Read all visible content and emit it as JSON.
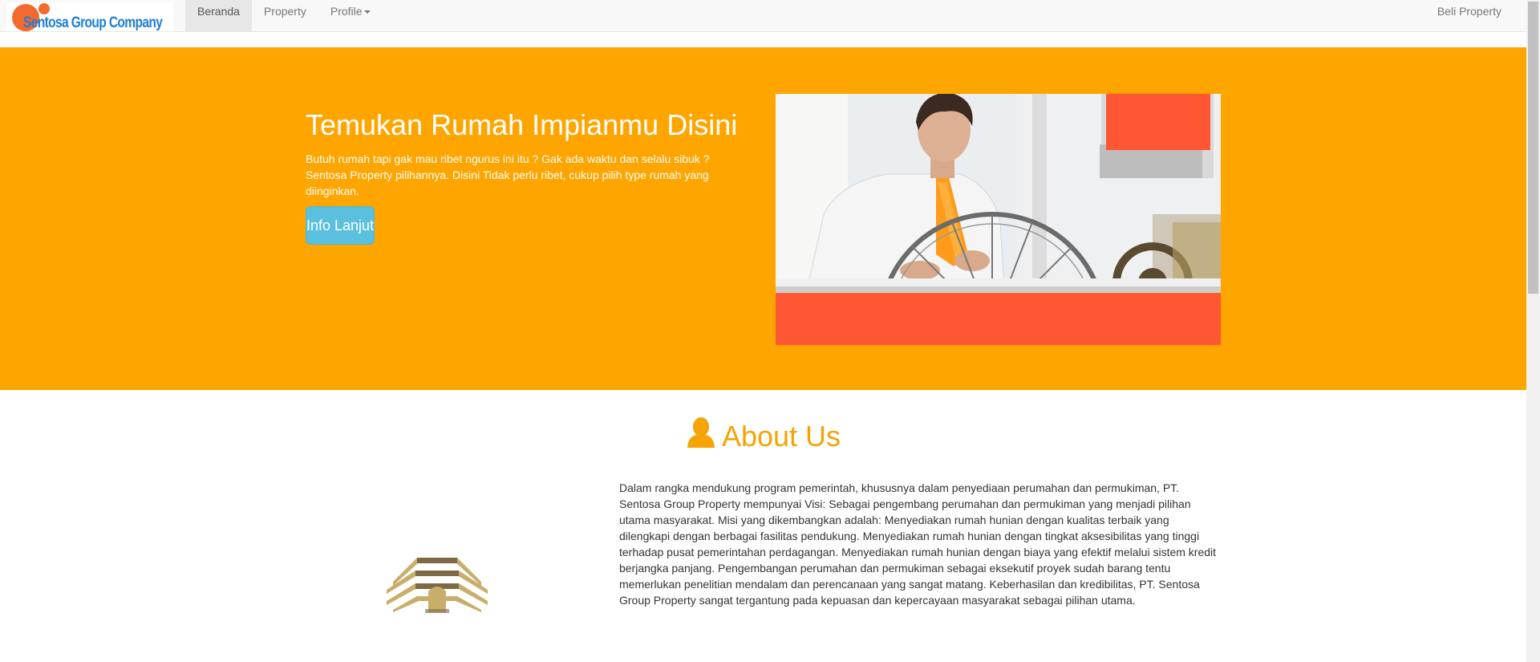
{
  "navbar": {
    "brand": {
      "text": "Sentosa Group Company",
      "icon": "logo-icon",
      "color": "#1e7fd6"
    },
    "items": [
      {
        "label": "Beranda",
        "active": true
      },
      {
        "label": "Property",
        "active": false
      },
      {
        "label": "Profile",
        "active": false,
        "dropdown": true
      }
    ],
    "right_link": "Beli Property"
  },
  "hero": {
    "background_color": "#ffa500",
    "title": "Temukan Rumah Impianmu Disini",
    "text": "Butuh rumah tapi gak mau ribet ngurus ini itu ? Gak ada waktu dan selalu sibuk ? Sentosa Property pilihannya. Disini Tidak perlu ribet, cukup pilih type rumah yang diinginkan.",
    "button_label": "Info Lanjut",
    "button_color": "#5bc0de",
    "image": "man-repairing-bicycle-wheel"
  },
  "about": {
    "icon": "user-icon",
    "heading": "About Us",
    "heading_color": "#f4a405",
    "logo": "building-logo-icon",
    "text": "Dalam rangka mendukung program pemerintah, khususnya dalam penyediaan perumahan dan permukiman, PT. Sentosa Group Property mempunyai Visi: Sebagai pengembang perumahan dan permukiman yang menjadi pilihan utama masyarakat. Misi yang dikembangkan adalah: Menyediakan rumah hunian dengan kualitas terbaik yang dilengkapi dengan berbagai fasilitas pendukung. Menyediakan rumah hunian dengan tingkat aksesibilitas yang tinggi terhadap pusat pemerintahan perdagangan. Menyediakan rumah hunian dengan biaya yang efektif melalui sistem kredit berjangka panjang. Pengembangan perumahan dan permukiman sebagai eksekutif proyek sudah barang tentu memerlukan penelitian mendalam dan perencanaan yang sangat matang. Keberhasilan dan kredibilitas, PT. Sentosa Group Property sangat tergantung pada kepuasan dan kepercayaan masyarakat sebagai pilihan utama."
  },
  "colors": {
    "accent_red": "#ff5733",
    "navbar_bg": "#f8f8f8"
  }
}
